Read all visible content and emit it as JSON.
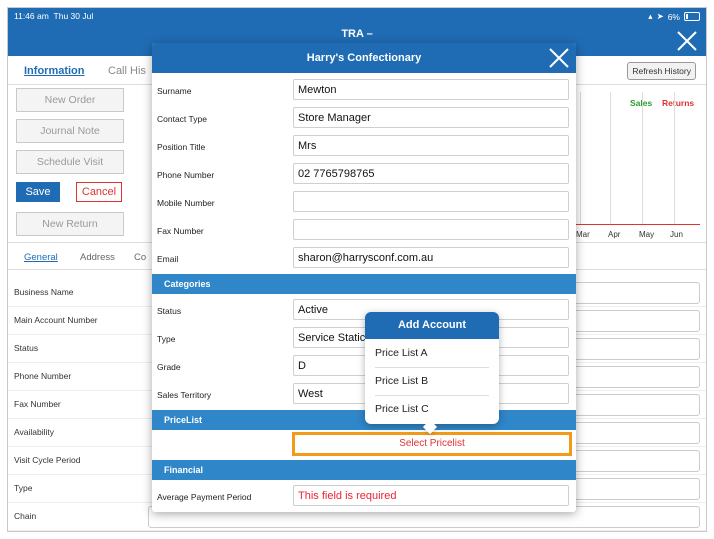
{
  "statusbar": {
    "time": "11:46 am",
    "date": "Thu 30 Jul",
    "battery": "6%"
  },
  "app": {
    "header_title": "TRA –"
  },
  "tabs": [
    {
      "label": "Information"
    },
    {
      "label": "Call His"
    }
  ],
  "refresh_label": "Refresh History",
  "left_buttons": {
    "new_order": "New Order",
    "journal_note": "Journal Note",
    "schedule_visit": "Schedule Visit",
    "save": "Save",
    "cancel": "Cancel",
    "new_return": "New Return"
  },
  "chart": {
    "legend": [
      "Sales",
      "Returns"
    ],
    "months": [
      "Mar",
      "Apr",
      "May",
      "Jun"
    ]
  },
  "subtabs": [
    {
      "label": "General"
    },
    {
      "label": "Address"
    },
    {
      "label": "Co"
    }
  ],
  "bg_fields": [
    "Business Name",
    "Main Account Number",
    "Status",
    "Phone Number",
    "Fax Number",
    "Availability",
    "Visit Cycle Period",
    "Type",
    "Chain"
  ],
  "modal": {
    "title": "Harry's Confectionary",
    "fields": [
      {
        "label": "Surname",
        "value": "Mewton"
      },
      {
        "label": "Contact Type",
        "value": "Store Manager"
      },
      {
        "label": "Position Title",
        "value": "Mrs"
      },
      {
        "label": "Phone Number",
        "value": "02 7765798765"
      },
      {
        "label": "Mobile Number",
        "value": ""
      },
      {
        "label": "Fax Number",
        "value": ""
      },
      {
        "label": "Email",
        "value": "sharon@harrysconf.com.au"
      }
    ],
    "categories_title": "Categories",
    "categories": [
      {
        "label": "Status",
        "value": "Active"
      },
      {
        "label": "Type",
        "value": "Service Static"
      },
      {
        "label": "Grade",
        "value": "D"
      },
      {
        "label": "Sales Territory",
        "value": "West"
      }
    ],
    "pricelist_title": "PriceList",
    "select_pricelist": "Select Pricelist",
    "financial_title": "Financial",
    "financial": {
      "label": "Average Payment Period",
      "value": "This field is required"
    }
  },
  "popover": {
    "title": "Add Account",
    "items": [
      "Price List A",
      "Price List B",
      "Price List C"
    ]
  },
  "colors": {
    "primary": "#1f6cb4",
    "section": "#2f86c9",
    "highlight": "#f39a1b",
    "error": "#dd3333"
  }
}
